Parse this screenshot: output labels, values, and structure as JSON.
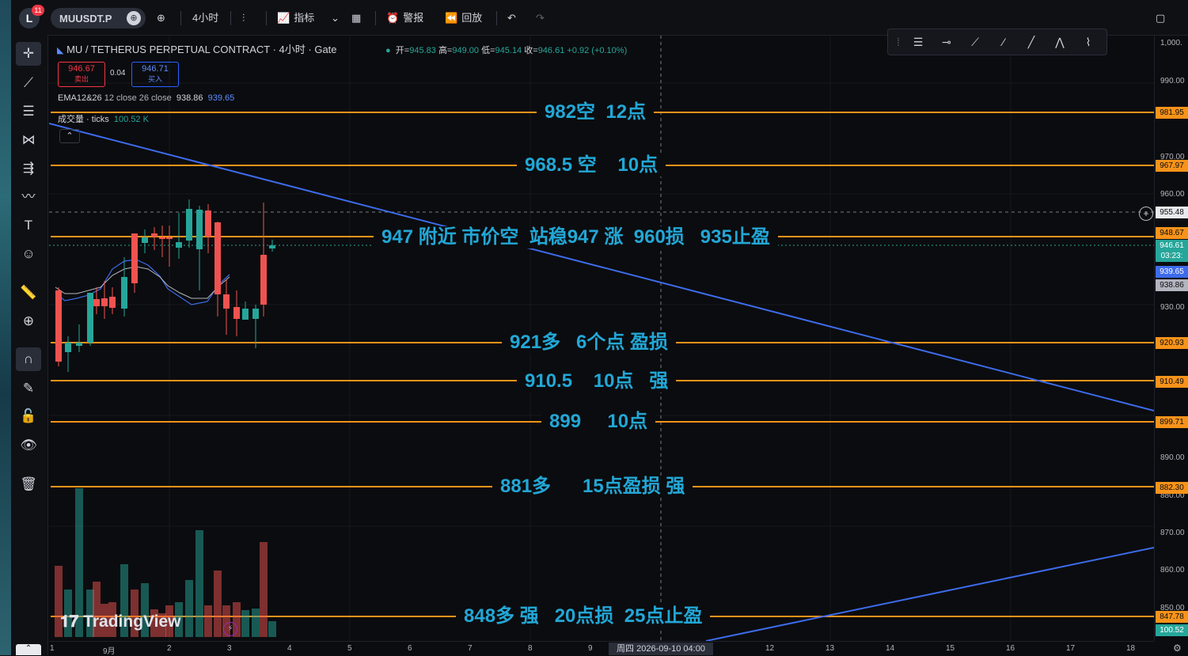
{
  "toolbar": {
    "logo_letter": "L",
    "badge": "11",
    "symbol": "MUUSDT.P",
    "interval": "4小时",
    "indicators": "指标",
    "alerts": "警报",
    "replay": "回放"
  },
  "legend": {
    "title": "MU / TETHERUS PERPETUAL CONTRACT · 4小时 · Gate",
    "open_label": "开=",
    "open": "945.83",
    "high_label": "高=",
    "high": "949.00",
    "low_label": "低=",
    "low": "945.14",
    "close_label": "收=",
    "close": "946.61",
    "change": "+0.92 (+0.10%)",
    "sell_price": "946.67",
    "sell_label": "卖出",
    "spread": "0.04",
    "buy_price": "946.71",
    "buy_label": "买入",
    "ema_name": "EMA12&26",
    "ema_params": "12 close 26 close",
    "ema_value_1": "938.86",
    "ema_value_2": "939.65",
    "volume_name": "成交量 · ticks",
    "volume_value": "100.52 K"
  },
  "annotations": [
    "982空  12点",
    "968.5 空    10点",
    "947 附近 市价空  站稳947 涨  960损   935止盈",
    "921多   6个点 盈损",
    "910.5    10点   强",
    "899     10点",
    "881多      15点盈损 强",
    "848多 强   20点损  25点止盈"
  ],
  "price_axis": {
    "ticks": [
      "1,000.",
      "990.00",
      "970.00",
      "960.00",
      "930.00",
      "890.00",
      "880.00",
      "870.00",
      "860.00",
      "850.00"
    ],
    "tags": [
      "981.95",
      "967.97",
      "955.48",
      "948.67",
      "946.61",
      "03:23:",
      "939.65",
      "938.86",
      "920.93",
      "910.49",
      "899.71",
      "882.30",
      "847.78",
      "100.52"
    ]
  },
  "time_axis": {
    "ticks": [
      "1",
      "9月",
      "2",
      "3",
      "4",
      "5",
      "6",
      "7",
      "8",
      "9",
      "12",
      "13",
      "14",
      "15",
      "16",
      "17",
      "18"
    ],
    "crosshair": "周四 2026-09-10   04:00"
  },
  "brand": "TradingView",
  "colors": {
    "up": "#26a69a",
    "down": "#ef5350",
    "level_line": "#f7931a",
    "trend_line": "#3d6bea",
    "annotation": "#22a7d6"
  }
}
